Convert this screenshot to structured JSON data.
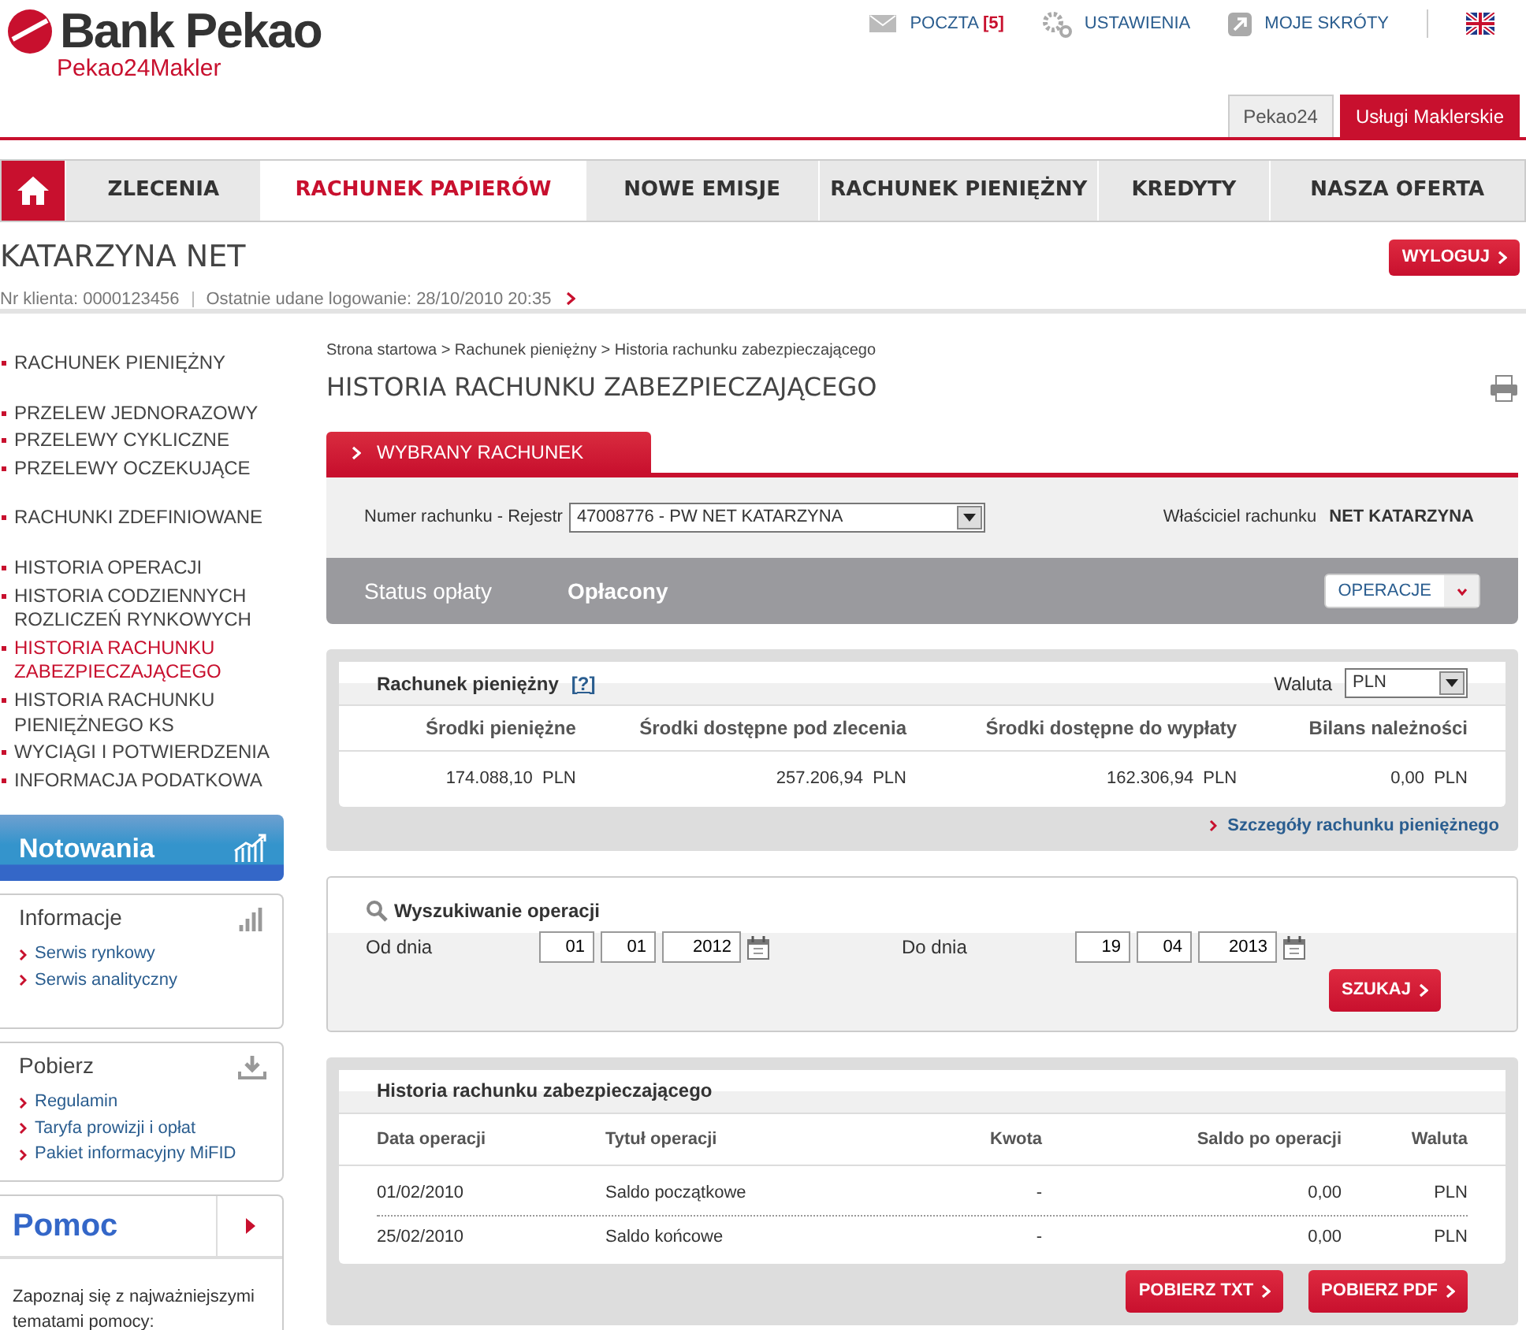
{
  "header": {
    "logo": "Bank Pekao",
    "sublogo": "Pekao24Makler",
    "links": [
      {
        "kind": "mail",
        "label": "POCZTA",
        "count": "[5]"
      },
      {
        "kind": "gear",
        "label": "USTAWIENIA"
      },
      {
        "kind": "shortcut",
        "label": "MOJE SKRÓTY"
      }
    ]
  },
  "site_tabs": [
    {
      "label": "Pekao24",
      "selected": false
    },
    {
      "label": "Usługi Maklerskie",
      "selected": true
    }
  ],
  "main_nav": [
    {
      "label": "ZLECENIA",
      "selected": false
    },
    {
      "label": "RACHUNEK PAPIERÓW",
      "selected": true
    },
    {
      "label": "NOWE EMISJE",
      "selected": false
    },
    {
      "label": "RACHUNEK PIENIĘŻNY",
      "selected": false
    },
    {
      "label": "KREDYTY",
      "selected": false
    },
    {
      "label": "NASZA OFERTA",
      "selected": false
    }
  ],
  "user": {
    "name": "KATARZYNA NET",
    "client": "Nr klienta: 0000123456",
    "last_login": "Ostatnie udane logowanie: 28/10/2010 20:35",
    "logout": "WYLOGUJ"
  },
  "sidebar": {
    "groups": [
      [
        {
          "label": "RACHUNEK PIENIĘŻNY",
          "selected": false
        }
      ],
      [
        {
          "label": "PRZELEW JEDNORAZOWY",
          "selected": false
        },
        {
          "label": "PRZELEWY CYKLICZNE",
          "selected": false
        },
        {
          "label": "PRZELEWY OCZEKUJĄCE",
          "selected": false
        }
      ],
      [
        {
          "label": "RACHUNKI ZDEFINIOWANE",
          "selected": false
        }
      ],
      [
        {
          "label": "HISTORIA OPERACJI",
          "selected": false
        },
        {
          "label": "HISTORIA CODZIENNYCH ROZLICZEŃ RYNKOWYCH",
          "selected": false
        },
        {
          "label": "HISTORIA RACHUNKU ZABEZPIECZAJĄCEGO",
          "selected": true
        },
        {
          "label": "HISTORIA RACHUNKU PIENIĘŻNEGO KS",
          "selected": false
        },
        {
          "label": "WYCIĄGI I POTWIERDZENIA",
          "selected": false
        },
        {
          "label": "INFORMACJA PODATKOWA",
          "selected": false
        }
      ]
    ]
  },
  "quotes": {
    "title": "Notowania"
  },
  "panels": [
    {
      "kind": "signal",
      "title": "Informacje",
      "links": [
        "Serwis rynkowy",
        "Serwis analityczny"
      ]
    },
    {
      "kind": "download",
      "title": "Pobierz",
      "links": [
        "Regulamin",
        "Taryfa prowizji i opłat",
        "Pakiet informacyjny MiFID"
      ]
    }
  ],
  "help": {
    "title": "Pomoc",
    "text": "Zapoznaj się z najważniejszymi tematami pomocy:"
  },
  "breadcrumb": "Strona startowa > Rachunek pieniężny > Historia rachunku zabezpieczającego",
  "page_title": "HISTORIA RACHUNKU ZABEZPIECZAJĄCEGO",
  "account_tab": "WYBRANY RACHUNEK",
  "account": {
    "label": "Numer rachunku - Rejestr",
    "value": "47008776 - PW NET KATARZYNA",
    "owner_label": "Właściciel rachunku",
    "owner": "NET KATARZYNA"
  },
  "status": {
    "label": "Status opłaty",
    "value": "Opłacony",
    "button": "OPERACJE"
  },
  "cash": {
    "title": "Rachunek pieniężny",
    "help": "[?]",
    "currency_label": "Waluta",
    "currency": "PLN",
    "columns": [
      "Środki pieniężne",
      "Środki dostępne pod zlecenia",
      "Środki dostępne do wypłaty",
      "Bilans należności"
    ],
    "values": [
      {
        "amount": "174.088,10",
        "currency": "PLN"
      },
      {
        "amount": "257.206,94",
        "currency": "PLN"
      },
      {
        "amount": "162.306,94",
        "currency": "PLN"
      },
      {
        "amount": "0,00",
        "currency": "PLN"
      }
    ],
    "details_link": "Szczegóły rachunku pieniężnego"
  },
  "search": {
    "title": "Wyszukiwanie operacji",
    "ranges": [
      {
        "label": "Od dnia",
        "day": "01",
        "month": "01",
        "year": "2012"
      },
      {
        "label": "Do dnia",
        "day": "19",
        "month": "04",
        "year": "2013"
      }
    ],
    "button": "SZUKAJ"
  },
  "history": {
    "title": "Historia rachunku zabezpieczającego",
    "columns": [
      "Data operacji",
      "Tytuł operacji",
      "Kwota",
      "Saldo po operacji",
      "Waluta"
    ],
    "rows": [
      [
        "01/02/2010",
        "Saldo początkowe",
        "-",
        "0,00",
        "PLN"
      ],
      [
        "25/02/2010",
        "Saldo końcowe",
        "-",
        "0,00",
        "PLN"
      ]
    ],
    "buttons": [
      "POBIERZ TXT",
      "POBIERZ PDF"
    ]
  }
}
